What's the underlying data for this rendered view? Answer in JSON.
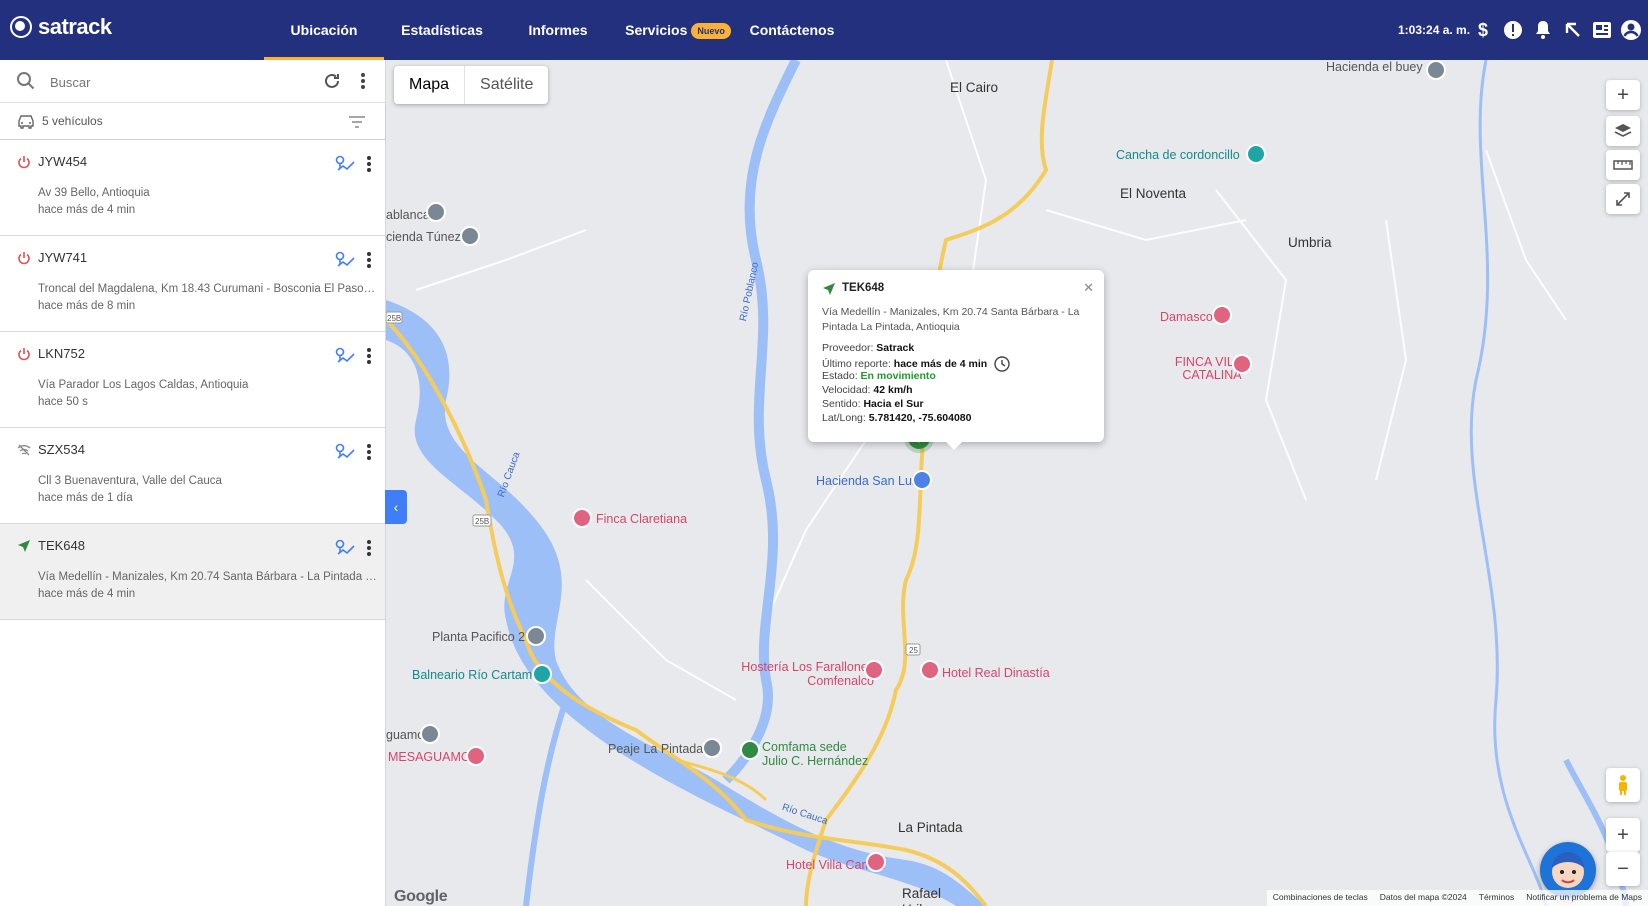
{
  "app": {
    "brand": "satrack"
  },
  "nav": {
    "items": [
      {
        "label": "Ubicación",
        "active": true
      },
      {
        "label": "Estadísticas"
      },
      {
        "label": "Informes"
      },
      {
        "label": "Servicios",
        "badge": "Nuevo"
      },
      {
        "label": "Contáctenos"
      }
    ],
    "time": "1:03:24 a. m.",
    "icons": [
      "dollar-icon",
      "alert-icon",
      "bell-icon",
      "arrow-northwest-icon",
      "news-icon",
      "account-icon"
    ],
    "colors": {
      "bar": "#23307e",
      "accent": "#f9b233"
    }
  },
  "sidebar": {
    "search_placeholder": "Buscar",
    "vehicle_count": "5 vehículos",
    "vehicles": [
      {
        "plate": "JYW454",
        "address": "Av 39 Bello, Antioquia",
        "ago": "hace más de 4 min",
        "status": "power-off"
      },
      {
        "plate": "JYW741",
        "address": "Troncal del Magdalena, Km 18.43 Curumani - Bosconia El Paso, Cesar",
        "ago": "hace más de 8 min",
        "status": "power-off"
      },
      {
        "plate": "LKN752",
        "address": "Vía Parador Los Lagos Caldas, Antioquia",
        "ago": "hace 50 s",
        "status": "power-off"
      },
      {
        "plate": "SZX534",
        "address": "Cll 3 Buenaventura, Valle del Cauca",
        "ago": "hace más de 1 día",
        "status": "no-signal"
      },
      {
        "plate": "TEK648",
        "address": "Vía Medellín - Manizales, Km 20.74 Santa Bárbara - La Pintada La Pintada, Antioquia",
        "ago": "hace más de 4 min",
        "status": "moving",
        "selected": true
      }
    ]
  },
  "map": {
    "type_buttons": [
      "Mapa",
      "Satélite"
    ],
    "places": {
      "el_cairo": "El Cairo",
      "hacienda_el_buey": "Hacienda el buey",
      "cancha": "Cancha de cordoncillo",
      "el_noventa": "El Noventa",
      "umbria": "Umbria",
      "damasco": "Damasco",
      "finca_villa_catalina": "FINCA VILLA CATALINA",
      "ablanca": "ablanca",
      "hacienda_tunez": "cienda Túnez",
      "rio_poblanco": "Río Poblanco",
      "rio_cauca_1": "Río Cauca",
      "rio_cauca_2": "Río Cauca",
      "hacienda_san_luis": "Hacienda San Luis",
      "finca_claretiana": "Finca Claretiana",
      "planta_pacifico": "Planta Pacifico 2",
      "balneario": "Balneario Río Cartama",
      "hosteria": "Hostería Los Farallones Comfenalco",
      "hotel_real": "Hotel Real Dinastía",
      "guamo": "guamo",
      "mesaguamo": "MESAGUAMO",
      "peaje": "Peaje La Pintada",
      "comfama": "Comfama sede Julio C. Hernández",
      "la_pintada": "La Pintada",
      "hotel_villa_camila": "Hotel Villa Camila",
      "rafael_uribe": "Rafael Uribe Uribe",
      "road_25": "25",
      "road_25b_1": "25B",
      "road_25b_2": "25B"
    },
    "popup": {
      "title": "TEK648",
      "address": "Vía Medellín - Manizales, Km 20.74 Santa Bárbara - La Pintada La Pintada, Antioquia",
      "provider_label": "Proveedor:",
      "provider": "Satrack",
      "report_label": "Último reporte:",
      "report": "hace más de 4 min",
      "state_label": "Estado:",
      "state": "En movimiento",
      "speed_label": "Velocidad:",
      "speed": "42 km/h",
      "direction_label": "Sentido:",
      "direction": "Hacia el Sur",
      "latlong_label": "Lat/Long:",
      "latlong": "5.781420, -75.604080"
    },
    "footer": {
      "google": "Google",
      "links": [
        "Combinaciones de teclas",
        "Datos del mapa ©2024",
        "Términos",
        "Notificar un problema de Maps"
      ]
    },
    "colors": {
      "water": "#9dbff7",
      "road": "#f5cc5c",
      "land": "#e8e9ec"
    }
  }
}
